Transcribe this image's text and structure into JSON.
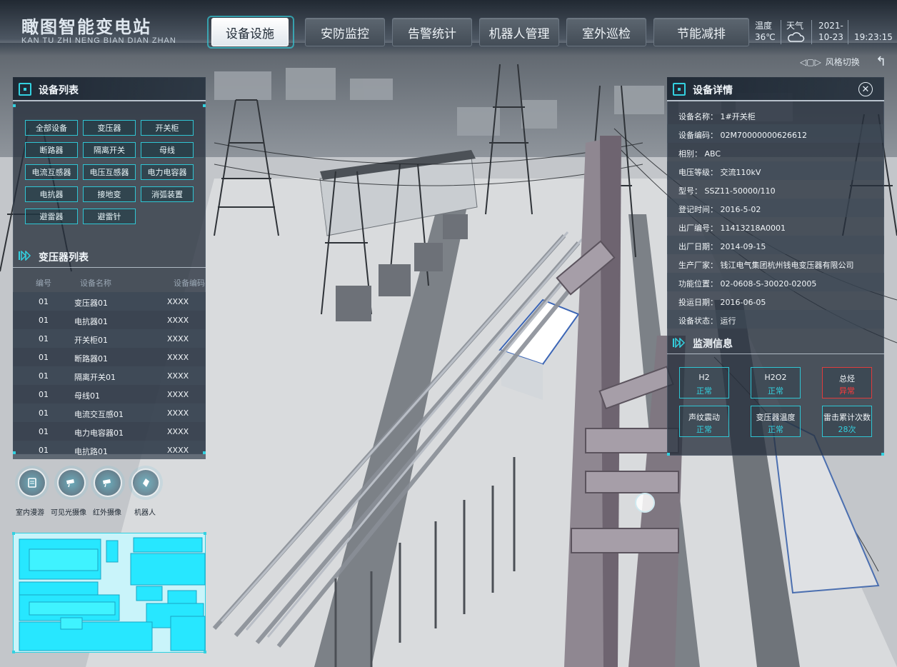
{
  "header": {
    "title": "瞰图智能变电站",
    "subtitle": "KAN TU ZHI NENG BIAN DIAN ZHAN",
    "nav": [
      "设备设施",
      "安防监控",
      "告警统计",
      "机器人管理",
      "室外巡检",
      "节能减排"
    ],
    "active_nav": 0,
    "temp_label": "温度",
    "temp_value": "36℃",
    "weather_label": "天气",
    "date_year": "2021-",
    "date_md": "10-23",
    "time": "19:23:15",
    "style_switch": "风格切换"
  },
  "device_list": {
    "title": "设备列表",
    "categories": [
      "全部设备",
      "变压器",
      "开关柜",
      "断路器",
      "隔离开关",
      "母线",
      "电流互感器",
      "电压互感器",
      "电力电容器",
      "电抗器",
      "接地变",
      "消弧装置",
      "避雷器",
      "避雷针"
    ]
  },
  "transformer_list": {
    "title": "变压器列表",
    "columns": [
      "编号",
      "设备名称",
      "设备编码"
    ],
    "rows": [
      {
        "id": "01",
        "name": "变压器01",
        "code": "XXXX"
      },
      {
        "id": "01",
        "name": "电抗器01",
        "code": "XXXX"
      },
      {
        "id": "01",
        "name": "开关柜01",
        "code": "XXXX"
      },
      {
        "id": "01",
        "name": "断路器01",
        "code": "XXXX"
      },
      {
        "id": "01",
        "name": "隔离开关01",
        "code": "XXXX"
      },
      {
        "id": "01",
        "name": "母线01",
        "code": "XXXX"
      },
      {
        "id": "01",
        "name": "电流交互感01",
        "code": "XXXX"
      },
      {
        "id": "01",
        "name": "电力电容器01",
        "code": "XXXX"
      },
      {
        "id": "01",
        "name": "电抗路01",
        "code": "XXXX"
      }
    ]
  },
  "tools": [
    "室内漫游",
    "可见光摄像",
    "红外摄像",
    "机器人"
  ],
  "device_detail": {
    "title": "设备详情",
    "rows": [
      "设备名称： 1#开关柜",
      "设备编码： 02M70000000626612",
      "相别： ABC",
      "电压等级： 交流110kV",
      "型号： SSZ11-50000/110",
      "登记时间： 2016-5-02",
      "出厂编号： 11413218A0001",
      "出厂日期： 2014-09-15",
      "生产厂家： 钱江电气集团杭州钱电变压器有限公司",
      "功能位置： 02-0608-S-30020-02005",
      "投运日期： 2016-06-05",
      "设备状态： 运行"
    ]
  },
  "monitor": {
    "title": "监测信息",
    "items": [
      {
        "name": "H2",
        "status": "正常",
        "alarm": false
      },
      {
        "name": "H2O2",
        "status": "正常",
        "alarm": false
      },
      {
        "name": "总烃",
        "status": "异常",
        "alarm": true
      },
      {
        "name": "声纹震动",
        "status": "正常",
        "alarm": false
      },
      {
        "name": "变压器温度",
        "status": "正常",
        "alarm": false
      },
      {
        "name": "雷击累计次数",
        "status": "28次",
        "alarm": false
      }
    ]
  },
  "colors": {
    "accent": "#33d1e0",
    "alarm": "#ff3a3a",
    "panel": "#26303c"
  }
}
